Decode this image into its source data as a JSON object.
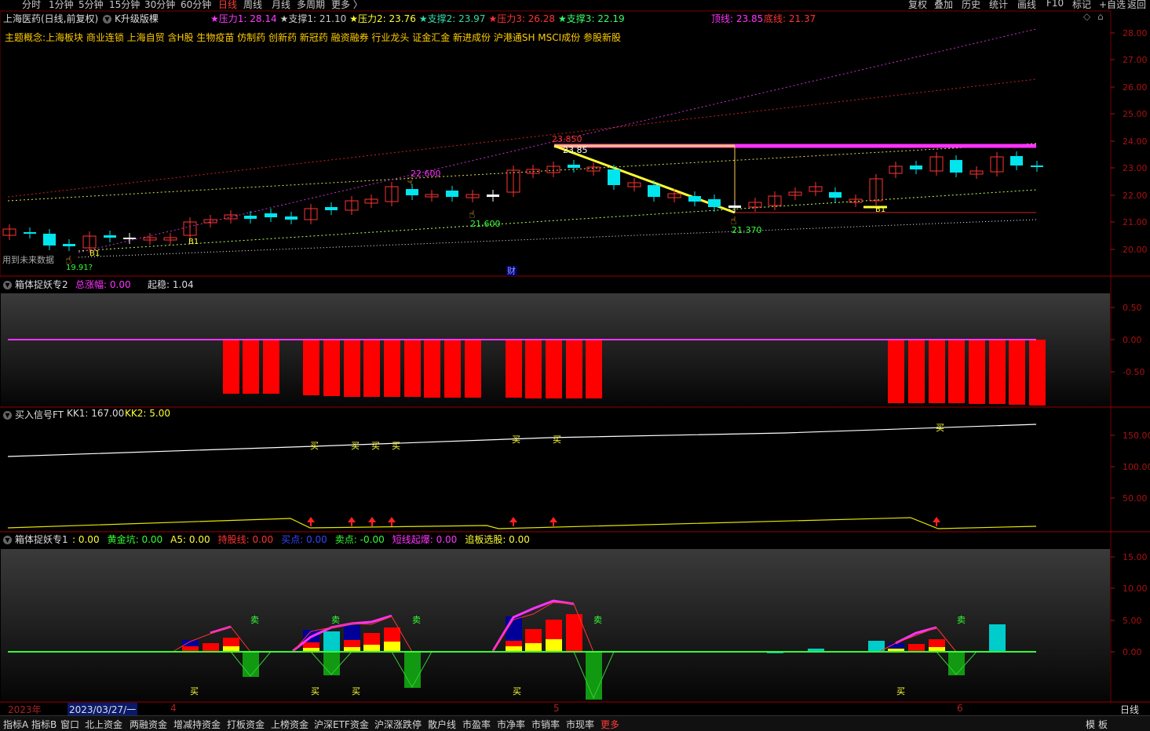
{
  "toolbar": {
    "tabs": [
      "分时",
      "1分钟",
      "5分钟",
      "15分钟",
      "30分钟",
      "60分钟",
      "日线",
      "周线",
      "月线",
      "多周期",
      "更多 〉"
    ],
    "active_tab": "日线",
    "right_buttons": [
      "复权",
      "叠加",
      "历史",
      "统计",
      "画线",
      "F10",
      "标记",
      "+自选",
      "返回"
    ]
  },
  "main": {
    "title": "上海医药(日线,前复权)",
    "indicator_name": "K升级版棵",
    "pressure_support": [
      {
        "label": "★压力1:",
        "value": "28.14",
        "color": "#ff3bff"
      },
      {
        "label": "★支撑1:",
        "value": "21.10",
        "color": "#c8c8c8"
      },
      {
        "label": "★压力2:",
        "value": "23.76",
        "color": "#ffff33"
      },
      {
        "label": "★支撑2:",
        "value": "23.97",
        "color": "#33ddaa"
      },
      {
        "label": "★压力3:",
        "value": "26.28",
        "color": "#ff3333"
      },
      {
        "label": "★支撑3:",
        "value": "22.19",
        "color": "#33ff66"
      }
    ],
    "top_line": {
      "label": "顶线:",
      "value": "23.85"
    },
    "bottom_line": {
      "label": "底线:",
      "value": "21.37"
    },
    "concept_label": "主题概念:",
    "concepts": "上海板块 商业连锁 上海自贸 含H股 生物疫苗 仿制药 创新药 新冠药  融资融券 行业龙头 证金汇金 新进成份 沪港通SH MSCI成份 参股新股",
    "future_data_label": "用到未来数据",
    "fin_mark": "财",
    "price_labels": {
      "high": "23.850",
      "high2": "23.85",
      "mid": "22.600",
      "low1": "21.600",
      "low2": "21.370",
      "b1": "B1",
      "b2": "B1",
      "b3": "B1",
      "left_low": "19.91?"
    },
    "y_axis": [
      "28.00",
      "27.00",
      "26.00",
      "25.00",
      "24.00",
      "23.00",
      "22.00",
      "21.00",
      "20.00"
    ]
  },
  "panel2": {
    "name": "箱体捉妖专2",
    "field1": {
      "label": "总涨幅:",
      "value": "0.00"
    },
    "field2": {
      "label": "起稳:",
      "value": "1.04"
    },
    "y_axis": [
      "0.50",
      "0.00",
      "-0.50"
    ]
  },
  "panel3": {
    "name": "买入信号FT",
    "kk1": {
      "label": "KK1:",
      "value": "167.00"
    },
    "kk2": {
      "label": "KK2:",
      "value": "5.00"
    },
    "buy_label": "买",
    "y_axis": [
      "150.00",
      "100.00",
      "50.00"
    ]
  },
  "panel4": {
    "name": "箱体捉妖专1",
    "fields": [
      {
        "label": ": ",
        "value": "0.00",
        "color": "#ffff33"
      },
      {
        "label": "黄金坑:",
        "value": "0.00",
        "color": "#33ff33"
      },
      {
        "label": "A5:",
        "value": "0.00",
        "color": "#ffff33"
      },
      {
        "label": "持股线:",
        "value": "0.00",
        "color": "#ff3333"
      },
      {
        "label": "买点:",
        "value": "0.00",
        "color": "#3344ff"
      },
      {
        "label": "卖点:",
        "value": "-0.00",
        "color": "#33ff33"
      },
      {
        "label": "短线起爆:",
        "value": "0.00",
        "color": "#ff33ff"
      },
      {
        "label": "追板选股:",
        "value": "0.00",
        "color": "#ffff33"
      }
    ],
    "buy_label": "买",
    "sell_label": "卖",
    "y_axis": [
      "15.00",
      "10.00",
      "5.00",
      "0.00"
    ]
  },
  "timeline": {
    "year": "2023年",
    "date": "2023/03/27/一",
    "m4": "4",
    "m5": "5",
    "m6": "6",
    "period": "日线"
  },
  "bottom_tabs": [
    "指标A",
    "指标B",
    "窗口",
    "北上资金",
    "两融资金",
    "增减持资金",
    "打板资金",
    "上榜资金",
    "沪深ETF资金",
    "沪深涨跌停",
    "散户线",
    "市盈率",
    "市净率",
    "市销率",
    "市现率",
    "更多"
  ],
  "bottom_right": [
    "模",
    "板"
  ],
  "colors": {
    "up": "#ff3333",
    "down": "#00e5ee",
    "magenta": "#ff33ff",
    "yellow": "#ffff33",
    "axis_red": "#aa1111"
  }
}
